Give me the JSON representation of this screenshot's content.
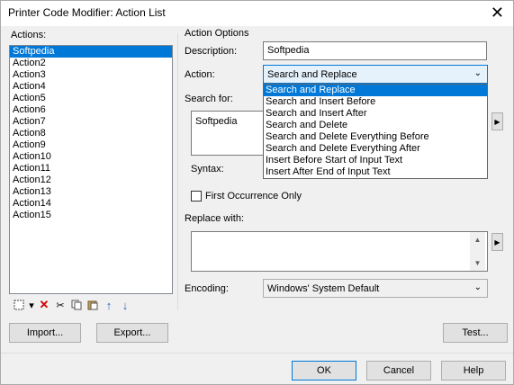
{
  "window": {
    "title": "Printer Code Modifier: Action List"
  },
  "actions_panel": {
    "label": "Actions:",
    "items": [
      "Softpedia",
      "Action2",
      "Action3",
      "Action4",
      "Action5",
      "Action6",
      "Action7",
      "Action8",
      "Action9",
      "Action10",
      "Action11",
      "Action12",
      "Action13",
      "Action14",
      "Action15"
    ],
    "selected_index": 0
  },
  "toolbar": {
    "icons": [
      "new-icon",
      "dropdown-arrow-icon",
      "delete-icon",
      "cut-icon",
      "copy-icon",
      "paste-icon",
      "move-up-icon",
      "move-down-icon"
    ]
  },
  "buttons": {
    "import": "Import...",
    "export": "Export...",
    "test": "Test...",
    "ok": "OK",
    "cancel": "Cancel",
    "help": "Help"
  },
  "options": {
    "group_label": "Action Options",
    "description_label": "Description:",
    "description_value": "Softpedia",
    "action_label": "Action:",
    "action_value": "Search and Replace",
    "search_label": "Search for:",
    "search_value": "Softpedia",
    "syntax_label": "Syntax:",
    "first_occurrence_label": "First Occurrence Only",
    "first_occurrence_checked": false,
    "replace_label": "Replace with:",
    "replace_value": "",
    "encoding_label": "Encoding:",
    "encoding_value": "Windows' System Default"
  },
  "action_dropdown": {
    "options": [
      "Search and Replace",
      "Search and Insert Before",
      "Search and Insert After",
      "Search and Delete",
      "Search and Delete Everything Before",
      "Search and Delete Everything After",
      "Insert Before Start of Input Text",
      "Insert After End of Input Text"
    ],
    "selected_index": 0
  },
  "colors": {
    "selection": "#0078d7",
    "window_bg": "#f0f0f0"
  }
}
